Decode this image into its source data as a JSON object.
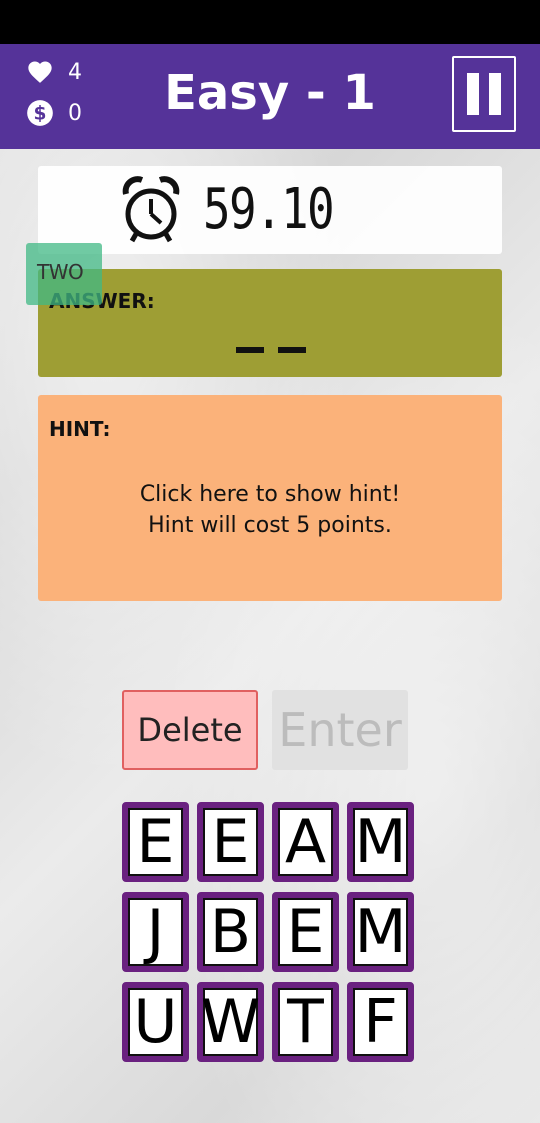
{
  "header": {
    "lives": "4",
    "coins": "0",
    "level_title": "Easy - 1",
    "icons": {
      "lives": "heart-icon",
      "coins": "dollar-coin-icon",
      "pause": "pause-icon"
    }
  },
  "timer": {
    "value": "59.10",
    "icon": "alarm-clock-icon"
  },
  "word_tag": "TWO",
  "answer": {
    "label": "ANSWER:",
    "slot_count": 2
  },
  "hint": {
    "label": "HINT:",
    "line1": "Click here to show hint!",
    "line2": "Hint will cost 5 points."
  },
  "buttons": {
    "delete": "Delete",
    "enter": "Enter"
  },
  "tiles": [
    [
      "E",
      "E",
      "A",
      "M"
    ],
    [
      "J",
      "B",
      "E",
      "M"
    ],
    [
      "U",
      "W",
      "T",
      "F"
    ]
  ],
  "colors": {
    "header_bg": "#553399",
    "answer_bg": "#9e9e34",
    "hint_bg": "#fbb27a",
    "tile_border": "#6a2180",
    "delete_bg": "#ffbdbd"
  }
}
